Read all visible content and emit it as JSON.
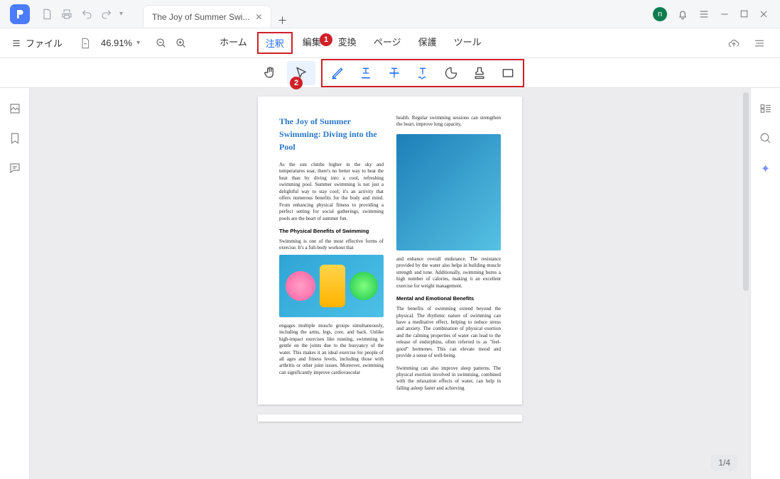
{
  "titlebar": {
    "tab_title": "The Joy of Summer Swi...",
    "avatar_letter": "n"
  },
  "menubar": {
    "file_label": "ファイル",
    "zoom": "46.91%",
    "items": [
      "ホーム",
      "注釈",
      "編集",
      "変換",
      "ページ",
      "保護",
      "ツール"
    ],
    "active_index": 1
  },
  "callouts": {
    "one": "1",
    "two": "2"
  },
  "document": {
    "title": "The Joy of Summer Swimming: Diving into the Pool",
    "para1": "As the sun climbs higher in the sky and temperatures soar, there's no better way to beat the heat than by diving into a cool, refreshing swimming pool. Summer swimming is not just a delightful way to stay cool; it's an activity that offers numerous benefits for the body and mind. From enhancing physical fitness to providing a perfect setting for social gatherings, swimming pools are the heart of summer fun.",
    "h1": "The Physical Benefits of Swimming",
    "para2": "Swimming is one of the most effective forms of exercise. It's a full-body workout that",
    "para3": "engages multiple muscle groups simultaneously, including the arms, legs, core, and back. Unlike high-impact exercises like running, swimming is gentle on the joints due to the buoyancy of the water. This makes it an ideal exercise for people of all ages and fitness levels, including those with arthritis or other joint issues. Moreover, swimming can significantly improve cardiovascular",
    "para_top_right": "health. Regular swimming sessions can strengthen the heart, improve lung capacity,",
    "para4": "and enhance overall endurance. The resistance provided by the water also helps in building muscle strength and tone. Additionally, swimming burns a high number of calories, making it an excellent exercise for weight management.",
    "h2": "Mental and Emotional Benefits",
    "para5": "The benefits of swimming extend beyond the physical. The rhythmic nature of swimming can have a meditative effect, helping to reduce stress and anxiety. The combination of physical exertion and the calming properties of water can lead to the release of endorphins, often referred to as \"feel-good\" hormones. This can elevate mood and provide a sense of well-being.",
    "para6": "Swimming can also improve sleep patterns. The physical exertion involved in swimming, combined with the relaxation effects of water, can help in falling asleep faster and achieving"
  },
  "page_indicator": "1/4"
}
